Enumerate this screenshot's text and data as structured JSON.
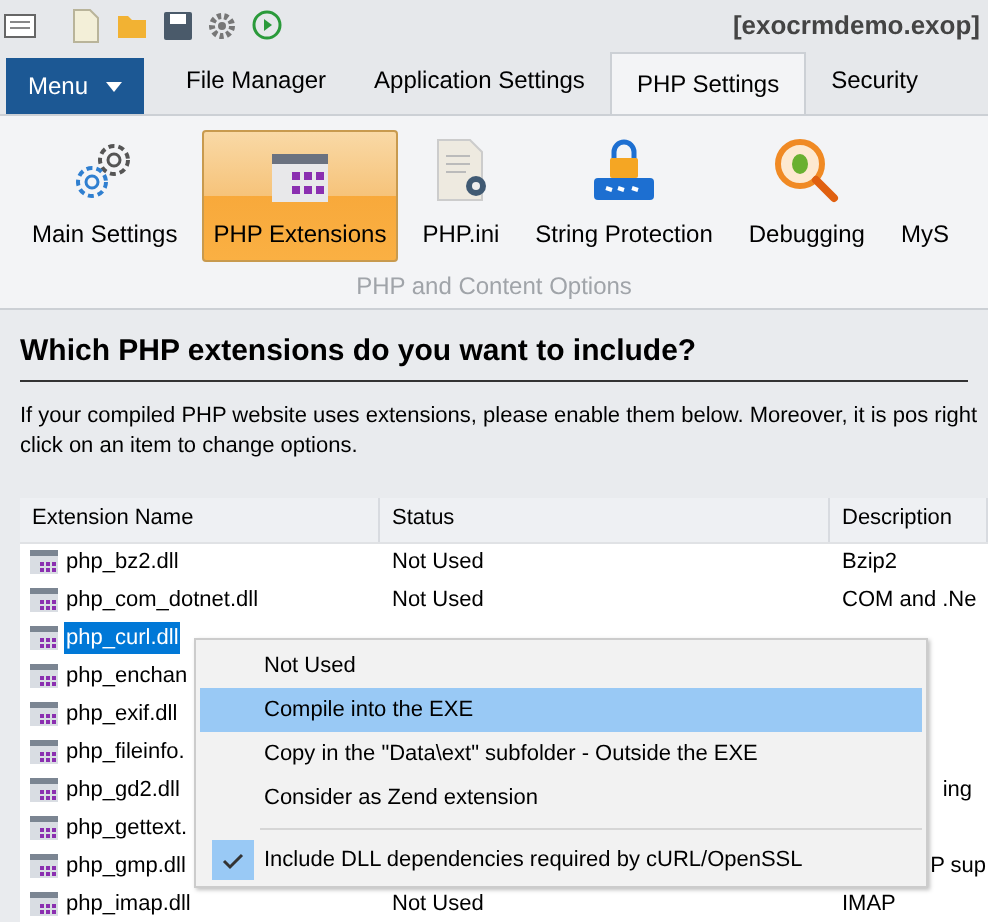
{
  "title_bar": {
    "file": "[exocrmdemo.exop]"
  },
  "menu_button": {
    "label": "Menu"
  },
  "tabs": [
    {
      "label": "File Manager",
      "selected": false
    },
    {
      "label": "Application Settings",
      "selected": false
    },
    {
      "label": "PHP Settings",
      "selected": true
    },
    {
      "label": "Security",
      "selected": false
    }
  ],
  "ribbon": {
    "buttons": [
      {
        "label": "Main Settings",
        "kind": "gears",
        "selected": false
      },
      {
        "label": "PHP Extensions",
        "kind": "extensions",
        "selected": true
      },
      {
        "label": "PHP.ini",
        "kind": "file",
        "selected": false
      },
      {
        "label": "String Protection",
        "kind": "lock",
        "selected": false
      },
      {
        "label": "Debugging",
        "kind": "bug",
        "selected": false
      },
      {
        "label": "MyS",
        "kind": "none",
        "selected": false
      }
    ],
    "group_label": "PHP and Content Options"
  },
  "heading": "Which PHP extensions do you want to include?",
  "intro": "If your compiled PHP website uses extensions, please enable them below. Moreover, it is pos right click on an item to change options.",
  "table": {
    "columns": [
      "Extension Name",
      "Status",
      "Description"
    ],
    "rows": [
      {
        "name": "php_bz2.dll",
        "status": "Not Used",
        "description": "Bzip2",
        "selected": false
      },
      {
        "name": "php_com_dotnet.dll",
        "status": "Not Used",
        "description": "COM and .Ne",
        "selected": false
      },
      {
        "name": "php_curl.dll",
        "selected": true
      },
      {
        "name": "php_enchan",
        "selected": false
      },
      {
        "name": "php_exif.dll",
        "selected": false
      },
      {
        "name": "php_fileinfo.",
        "selected": false
      },
      {
        "name": "php_gd2.dll",
        "description": "ing",
        "selected": false
      },
      {
        "name": "php_gettext.",
        "selected": false
      },
      {
        "name": "php_gmp.dll",
        "description": "P sup",
        "selected": false
      },
      {
        "name": "php_imap.dll",
        "status": "Not Used",
        "description": "IMAP",
        "selected": false
      }
    ]
  },
  "context_menu": {
    "items": [
      {
        "kind": "item",
        "label": "Not Used",
        "selected": false,
        "checked": false
      },
      {
        "kind": "item",
        "label": "Compile into the EXE",
        "selected": true,
        "checked": false
      },
      {
        "kind": "item",
        "label": "Copy in the \"Data\\ext\" subfolder - Outside the EXE",
        "selected": false,
        "checked": false
      },
      {
        "kind": "item",
        "label": "Consider as Zend extension",
        "selected": false,
        "checked": false
      },
      {
        "kind": "separator"
      },
      {
        "kind": "item",
        "label": "Include DLL dependencies required by cURL/OpenSSL",
        "selected": false,
        "checked": true
      }
    ]
  }
}
